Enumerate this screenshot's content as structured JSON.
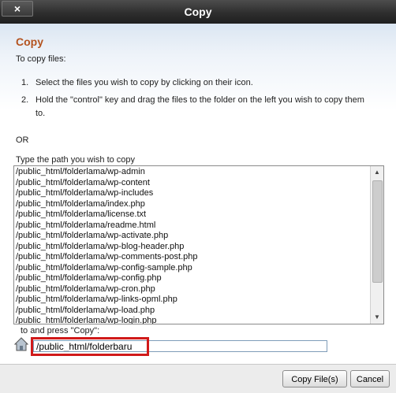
{
  "dialog": {
    "title": "Copy",
    "close_symbol": "×",
    "heading": "Copy",
    "intro": "To copy files:",
    "steps": [
      "Select the files you wish to copy by clicking on their icon.",
      "Hold the \"control\" key and drag the files to the folder on the left you wish to copy them",
      "to."
    ],
    "step_numbers": [
      "1.",
      "2."
    ],
    "or_label": "OR",
    "path_label": "Type the path you wish to copy",
    "paths": [
      "/public_html/folderlama/wp-admin",
      "/public_html/folderlama/wp-content",
      "/public_html/folderlama/wp-includes",
      "/public_html/folderlama/index.php",
      "/public_html/folderlama/license.txt",
      "/public_html/folderlama/readme.html",
      "/public_html/folderlama/wp-activate.php",
      "/public_html/folderlama/wp-blog-header.php",
      "/public_html/folderlama/wp-comments-post.php",
      "/public_html/folderlama/wp-config-sample.php",
      "/public_html/folderlama/wp-config.php",
      "/public_html/folderlama/wp-cron.php",
      "/public_html/folderlama/wp-links-opml.php",
      "/public_html/folderlama/wp-load.php",
      "/public_html/folderlama/wp-login.php"
    ],
    "dest_label": "to and press \"Copy\":",
    "dest_value": "/public_html/folderbaru",
    "copy_button": "Copy File(s)",
    "cancel_button": "Cancel"
  },
  "colors": {
    "heading": "#b4531f",
    "highlight": "#d01a1a",
    "titlebar": "#2e2e2e"
  },
  "icons": {
    "close": "close-icon",
    "home": "home-icon",
    "scroll_up": "scroll-up-icon",
    "scroll_down": "scroll-down-icon"
  }
}
